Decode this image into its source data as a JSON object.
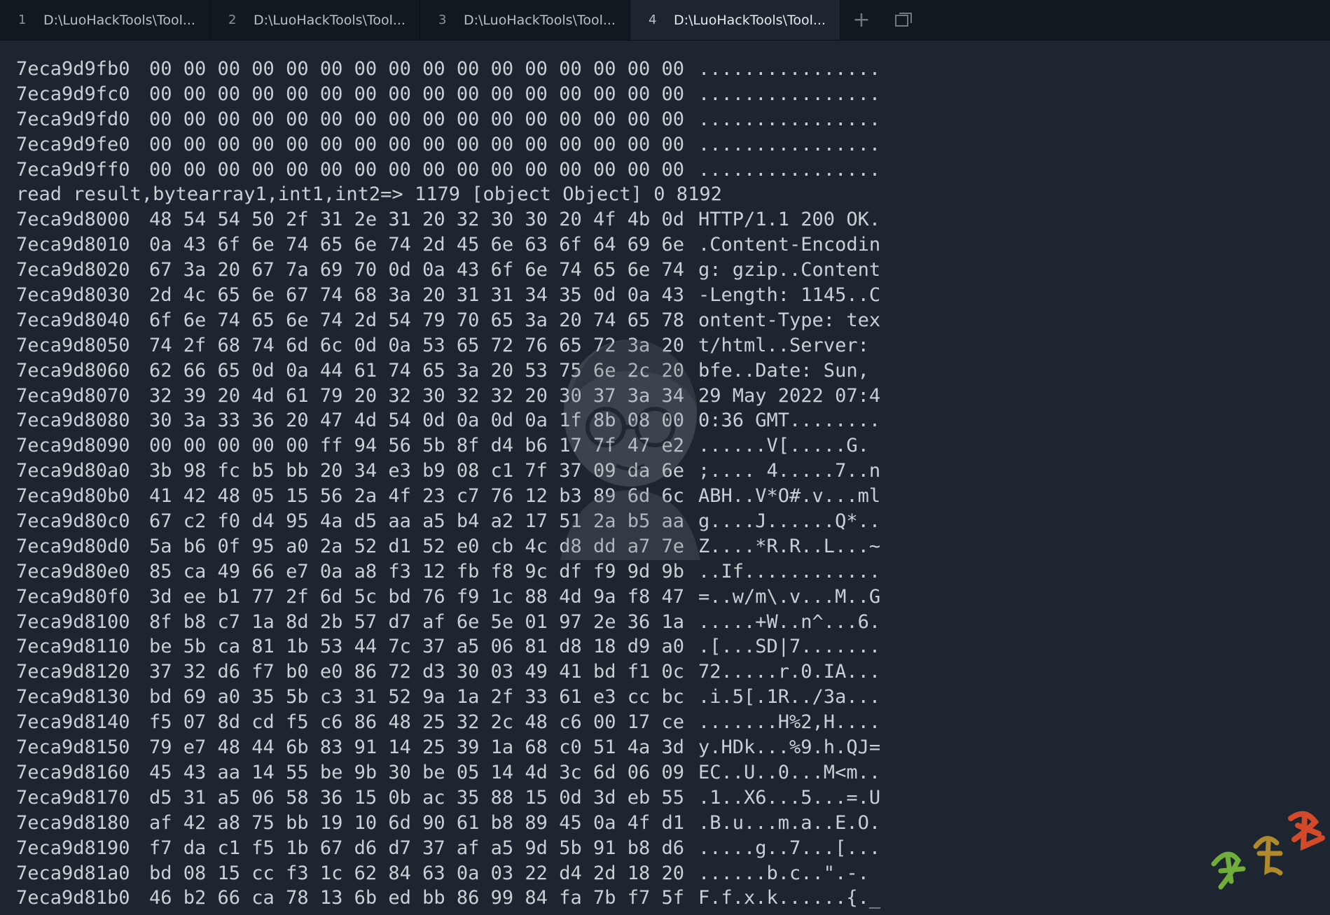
{
  "tabs": [
    {
      "num": "1",
      "label": "D:\\LuoHackTools\\Tool...",
      "active": false
    },
    {
      "num": "2",
      "label": "D:\\LuoHackTools\\Tool...",
      "active": false
    },
    {
      "num": "3",
      "label": "D:\\LuoHackTools\\Tool...",
      "active": false
    },
    {
      "num": "4",
      "label": "D:\\LuoHackTools\\Tool...",
      "active": true
    }
  ],
  "tab_controls": {
    "new_tab_glyph": "+",
    "restore_glyph": "⧉"
  },
  "terminal": {
    "lines": [
      {
        "addr": "7eca9d9fb0",
        "hex": "00 00 00 00 00 00 00 00 00 00 00 00 00 00 00 00",
        "ascii": "................"
      },
      {
        "addr": "7eca9d9fc0",
        "hex": "00 00 00 00 00 00 00 00 00 00 00 00 00 00 00 00",
        "ascii": "................"
      },
      {
        "addr": "7eca9d9fd0",
        "hex": "00 00 00 00 00 00 00 00 00 00 00 00 00 00 00 00",
        "ascii": "................"
      },
      {
        "addr": "7eca9d9fe0",
        "hex": "00 00 00 00 00 00 00 00 00 00 00 00 00 00 00 00",
        "ascii": "................"
      },
      {
        "addr": "7eca9d9ff0",
        "hex": "00 00 00 00 00 00 00 00 00 00 00 00 00 00 00 00",
        "ascii": "................"
      },
      {
        "text": "read result,bytearray1,int1,int2=> 1179 [object Object] 0 8192"
      },
      {
        "addr": "7eca9d8000",
        "hex": "48 54 54 50 2f 31 2e 31 20 32 30 30 20 4f 4b 0d",
        "ascii": "HTTP/1.1 200 OK."
      },
      {
        "addr": "7eca9d8010",
        "hex": "0a 43 6f 6e 74 65 6e 74 2d 45 6e 63 6f 64 69 6e",
        "ascii": ".Content-Encodin"
      },
      {
        "addr": "7eca9d8020",
        "hex": "67 3a 20 67 7a 69 70 0d 0a 43 6f 6e 74 65 6e 74",
        "ascii": "g: gzip..Content"
      },
      {
        "addr": "7eca9d8030",
        "hex": "2d 4c 65 6e 67 74 68 3a 20 31 31 34 35 0d 0a 43",
        "ascii": "-Length: 1145..C"
      },
      {
        "addr": "7eca9d8040",
        "hex": "6f 6e 74 65 6e 74 2d 54 79 70 65 3a 20 74 65 78",
        "ascii": "ontent-Type: tex"
      },
      {
        "addr": "7eca9d8050",
        "hex": "74 2f 68 74 6d 6c 0d 0a 53 65 72 76 65 72 3a 20",
        "ascii": "t/html..Server: "
      },
      {
        "addr": "7eca9d8060",
        "hex": "62 66 65 0d 0a 44 61 74 65 3a 20 53 75 6e 2c 20",
        "ascii": "bfe..Date: Sun, "
      },
      {
        "addr": "7eca9d8070",
        "hex": "32 39 20 4d 61 79 20 32 30 32 32 20 30 37 3a 34",
        "ascii": "29 May 2022 07:4"
      },
      {
        "addr": "7eca9d8080",
        "hex": "30 3a 33 36 20 47 4d 54 0d 0a 0d 0a 1f 8b 08 00",
        "ascii": "0:36 GMT........"
      },
      {
        "addr": "7eca9d8090",
        "hex": "00 00 00 00 00 ff 94 56 5b 8f d4 b6 17 7f 47 e2",
        "ascii": "......V[.....G."
      },
      {
        "addr": "7eca9d80a0",
        "hex": "3b 98 fc b5 bb 20 34 e3 b9 08 c1 7f 37 09 da 6e",
        "ascii": ";.... 4.....7..n"
      },
      {
        "addr": "7eca9d80b0",
        "hex": "41 42 48 05 15 56 2a 4f 23 c7 76 12 b3 89 6d 6c",
        "ascii": "ABH..V*O#.v...ml"
      },
      {
        "addr": "7eca9d80c0",
        "hex": "67 c2 f0 d4 95 4a d5 aa a5 b4 a2 17 51 2a b5 aa",
        "ascii": "g....J......Q*.."
      },
      {
        "addr": "7eca9d80d0",
        "hex": "5a b6 0f 95 a0 2a 52 d1 52 e0 cb 4c d8 dd a7 7e",
        "ascii": "Z....*R.R..L...~"
      },
      {
        "addr": "7eca9d80e0",
        "hex": "85 ca 49 66 e7 0a a8 f3 12 fb f8 9c df f9 9d 9b",
        "ascii": "..If............"
      },
      {
        "addr": "7eca9d80f0",
        "hex": "3d ee b1 77 2f 6d 5c bd 76 f9 1c 88 4d 9a f8 47",
        "ascii": "=..w/m\\.v...M..G"
      },
      {
        "addr": "7eca9d8100",
        "hex": "8f b8 c7 1a 8d 2b 57 d7 af 6e 5e 01 97 2e 36 1a",
        "ascii": ".....+W..n^...6."
      },
      {
        "addr": "7eca9d8110",
        "hex": "be 5b ca 81 1b 53 44 7c 37 a5 06 81 d8 18 d9 a0",
        "ascii": ".[...SD|7......."
      },
      {
        "addr": "7eca9d8120",
        "hex": "37 32 d6 f7 b0 e0 86 72 d3 30 03 49 41 bd f1 0c",
        "ascii": "72.....r.0.IA..."
      },
      {
        "addr": "7eca9d8130",
        "hex": "bd 69 a0 35 5b c3 31 52 9a 1a 2f 33 61 e3 cc bc",
        "ascii": ".i.5[.1R../3a..."
      },
      {
        "addr": "7eca9d8140",
        "hex": "f5 07 8d cd f5 c6 86 48 25 32 2c 48 c6 00 17 ce",
        "ascii": ".......H%2,H...."
      },
      {
        "addr": "7eca9d8150",
        "hex": "79 e7 48 44 6b 83 91 14 25 39 1a 68 c0 51 4a 3d",
        "ascii": "y.HDk...%9.h.QJ="
      },
      {
        "addr": "7eca9d8160",
        "hex": "45 43 aa 14 55 be 9b 30 be 05 14 4d 3c 6d 06 09",
        "ascii": "EC..U..0...M<m.."
      },
      {
        "addr": "7eca9d8170",
        "hex": "d5 31 a5 06 58 36 15 0b ac 35 88 15 0d 3d eb 55",
        "ascii": ".1..X6...5...=.U"
      },
      {
        "addr": "7eca9d8180",
        "hex": "af 42 a8 75 bb 19 10 6d 90 61 b8 89 45 0a 4f d1",
        "ascii": ".B.u...m.a..E.O."
      },
      {
        "addr": "7eca9d8190",
        "hex": "f7 da c1 f5 1b 67 d6 d7 37 af a5 9d 5b 91 b8 d6",
        "ascii": ".....g..7...[..."
      },
      {
        "addr": "7eca9d81a0",
        "hex": "bd 08 15 cc f3 1c 62 84 63 0a 03 22 d4 2d 18 20",
        "ascii": "......b.c..\".-. "
      },
      {
        "addr": "7eca9d81b0",
        "hex": "46 b2 66 ca 78 13 6b ed bb 86 99 84 fa 7b f7 5f",
        "ascii": "F.f.x.k......{._"
      }
    ]
  },
  "colors": {
    "background": "#1d2630",
    "tabbar": "#111820",
    "text": "#c9cfd4"
  }
}
